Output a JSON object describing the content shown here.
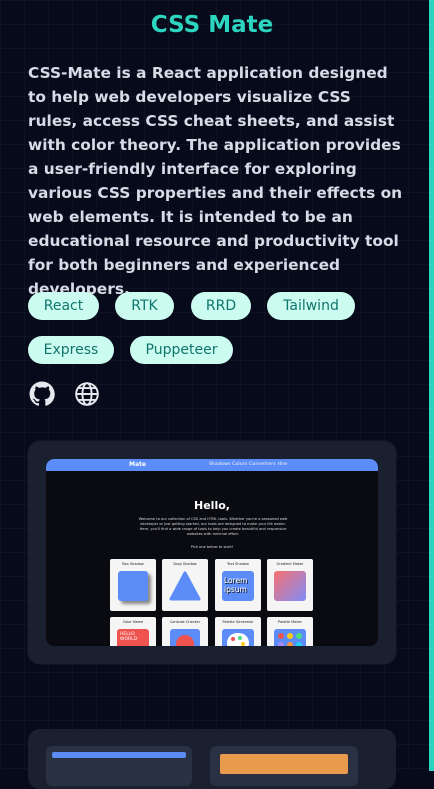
{
  "project": {
    "title": "CSS Mate",
    "description": "CSS-Mate is a React application designed to help web developers visualize CSS rules, access CSS cheat sheets, and assist with color theory. The application provides a user-friendly interface for exploring various CSS properties and their effects on web elements. It is intended to be an educational resource and productivity tool for both beginners and experienced developers."
  },
  "tags": [
    "React",
    "RTK",
    "RRD",
    "Tailwind",
    "Express",
    "Puppeteer"
  ],
  "links": {
    "github_icon": "github-icon",
    "website_icon": "globe-icon"
  },
  "preview": {
    "logo": "Mate",
    "nav_links": "Shadows   Colors   Converters   Hire",
    "heading": "Hello,",
    "intro": "Welcome to our collection of CSS and HTML tools. Whether you're a seasoned web developer or just getting started, our tools are designed to make your life easier. Here, you'll find a wide range of tools to help you create beautiful and responsive websites with minimal effort.",
    "cta": "Pick one below to start!",
    "tiles": [
      "Box Shadow",
      "Drop Shadow",
      "Text Shadow",
      "Gradient Maker",
      "Color Name",
      "Contrast Checker",
      "Palette Generator",
      "Palette Maker"
    ],
    "tile_text_shadow": "Lorem ipsum",
    "tile_color_name": "HELLO WORLD"
  },
  "colors": {
    "accent": "#2dd4bf",
    "background": "#060a1a",
    "tag_bg": "#ccfbef",
    "tag_text": "#0f766e",
    "preview_nav": "#5b8cf7"
  }
}
